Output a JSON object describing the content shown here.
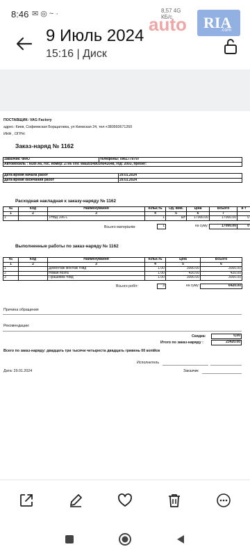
{
  "status_bar": {
    "time": "8:46",
    "icons_text": "✉ ◎ ~ ·",
    "mini_text": "8,57  4G",
    "mini_text2": "КБ/с"
  },
  "watermark": {
    "auto": "auto",
    "ria": "RIA",
    "domain": ".com"
  },
  "header": {
    "title": "9 Июль 2024",
    "subtitle": "15:16 | Диск"
  },
  "document": {
    "supplier_label": "ПОСТАВЩИК:",
    "supplier_name": "VAG Factory",
    "address": "адрес: Киев, Софиевская Борщаговка, ул Киевская 24, тел:+380993671260",
    "inn": "ИНН , ОГРН:",
    "order_title": "Заказ-наряд № 1162",
    "customer_label": "Заказчик: ФИО",
    "phones_label": "телефоны: 0961779797",
    "car_info": "Автомобиль : Audi A6, гос. номер: 2706 VIN: wauzzz4b03n041648, год: 2003, пробег:",
    "start_label": "Дата-время начала работ",
    "start_value": "29.01.2024",
    "end_label": "Дата-время окончания работ",
    "end_value": "29.01.2024",
    "invoice_title": "Расходная накладная к заказу-наряду №  1162",
    "invoice_headers": [
      "№",
      "Код",
      "Наименування",
      "Кільк.ть",
      "Од. вим.",
      "Ціна",
      "Всього",
      "в т"
    ],
    "invoice_numbers": [
      "1",
      "2",
      "3",
      "4",
      "5",
      "6",
      "7",
      ""
    ],
    "invoice_rows": [
      [
        "1",
        "",
        "ТНВД 106 L",
        "1",
        "шт",
        "17000.00",
        "17000.00",
        "0"
      ]
    ],
    "materials_total_label": "Всього матеріалів:",
    "materials_total_qty": "1",
    "sum_label": "на суму:",
    "materials_sum": "17000.00",
    "materials_extra": "0",
    "works_title": "Выполненные работы по заказ-наряду №  1162",
    "works_headers": [
      "№",
      "Код",
      "Наименування",
      "Кільк.ть",
      "Ціна",
      "Всього"
    ],
    "works_numbers": [
      "1",
      "2",
      "3",
      "4",
      "5",
      "6"
    ],
    "works_rows": [
      [
        "1",
        "",
        "Демонтаж монтаж тнвд",
        "1.00",
        "3000.00",
        "3000.00"
      ],
      [
        "2",
        "",
        "Новая поэта",
        "1.00",
        "420.00",
        "420.00"
      ],
      [
        "3",
        "",
        "Прашивка тнвд",
        "1.00",
        "3000.00",
        "3000.00"
      ]
    ],
    "works_total_label": "Всього робіт:",
    "works_total_qty": "3",
    "works_sum": "6420.00",
    "reason_label": "Причина обращения",
    "recommend_label": "Рекомендации:",
    "discount_label": "Скидка:",
    "discount_value": "0,00",
    "grand_total_label": "Итого по заказ-наряду :",
    "grand_total_value": "23420.00",
    "words_total": "Всего по заказ-наряду: двадцать три тысячи четыреста двадцать гривень 00 копійок",
    "executor_label": "Исполнитель",
    "date_label": "Дата: 29.01.2024",
    "client_label": "Заказчик"
  },
  "toolbar": {
    "share": "share-icon",
    "edit": "edit-icon",
    "favorite": "heart-icon",
    "delete": "trash-icon",
    "more": "more-icon"
  }
}
